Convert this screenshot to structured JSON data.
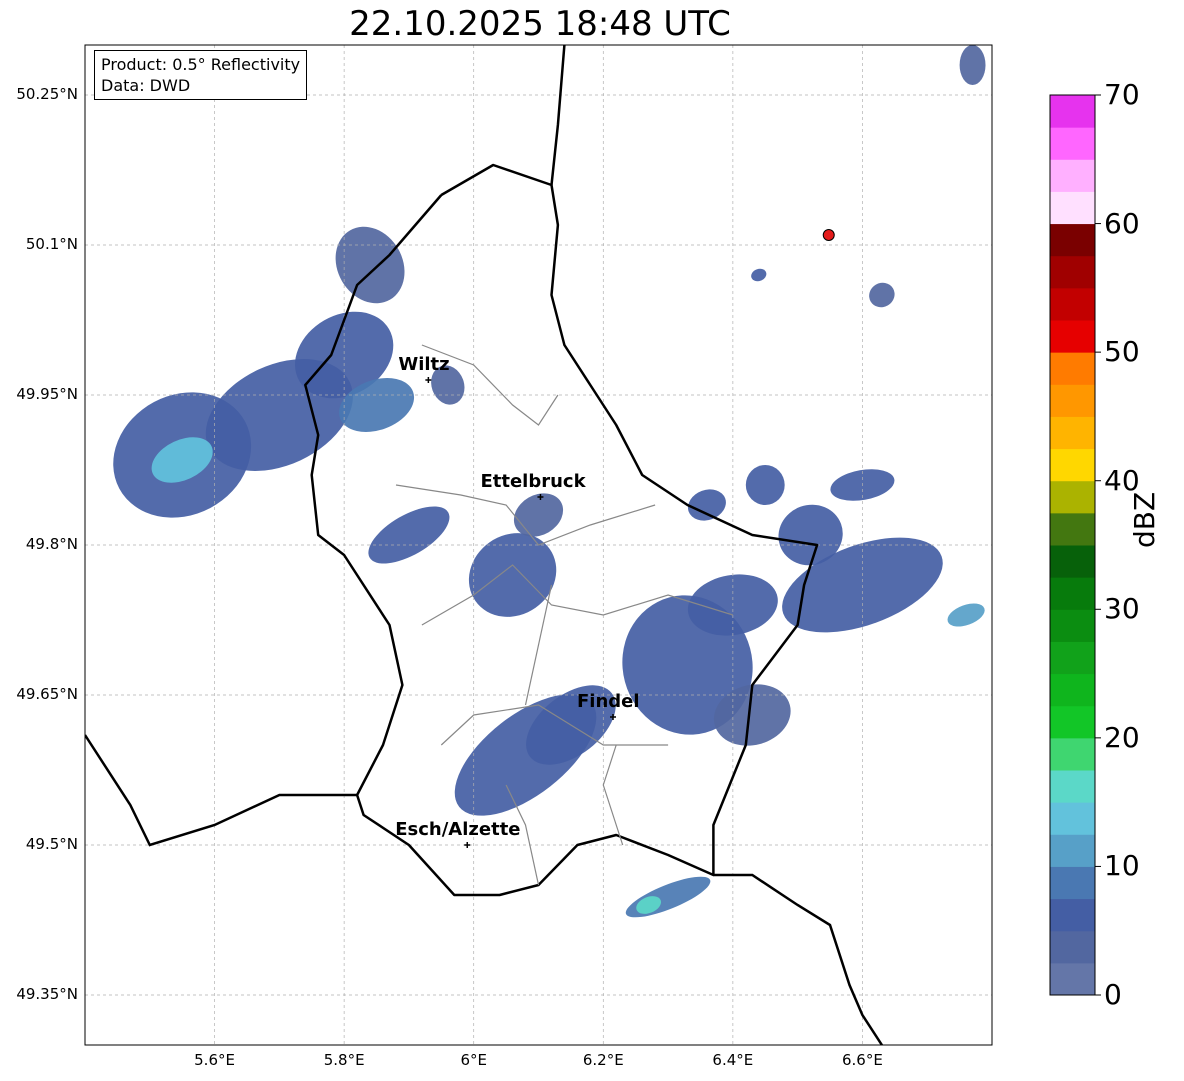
{
  "title": "22.10.2025 18:48 UTC",
  "info_box": {
    "product": "Product: 0.5° Reflectivity",
    "source": "Data: DWD"
  },
  "map": {
    "lon_range": [
      5.4,
      6.8
    ],
    "lat_range": [
      49.3,
      50.3
    ],
    "lat_ticks": [
      {
        "value": 50.25,
        "label": "50.25°N"
      },
      {
        "value": 50.1,
        "label": "50.1°N"
      },
      {
        "value": 49.95,
        "label": "49.95°N"
      },
      {
        "value": 49.8,
        "label": "49.8°N"
      },
      {
        "value": 49.65,
        "label": "49.65°N"
      },
      {
        "value": 49.5,
        "label": "49.5°N"
      },
      {
        "value": 49.35,
        "label": "49.35°N"
      }
    ],
    "lon_ticks": [
      {
        "value": 5.6,
        "label": "5.6°E"
      },
      {
        "value": 5.8,
        "label": "5.8°E"
      },
      {
        "value": 6.0,
        "label": "6°E"
      },
      {
        "value": 6.2,
        "label": "6.2°E"
      },
      {
        "value": 6.4,
        "label": "6.4°E"
      },
      {
        "value": 6.6,
        "label": "6.6°E"
      }
    ],
    "grid": true,
    "cities": [
      {
        "name": "Wiltz",
        "lon": 5.93,
        "lat": 49.965
      },
      {
        "name": "Ettelbruck",
        "lon": 6.103,
        "lat": 49.848
      },
      {
        "name": "Findel",
        "lon": 6.215,
        "lat": 49.628
      },
      {
        "name": "Esch/Alzette",
        "lon": 5.99,
        "lat": 49.5
      }
    ],
    "radar_site": {
      "lon": 6.548,
      "lat": 50.11,
      "color": "#e51b1b"
    },
    "echoes": [
      {
        "lon": 5.55,
        "lat": 49.89,
        "rx": 0.11,
        "ry": 0.06,
        "angle": -28,
        "dbz": 6
      },
      {
        "lon": 5.7,
        "lat": 49.93,
        "rx": 0.12,
        "ry": 0.05,
        "angle": -25,
        "dbz": 6
      },
      {
        "lon": 5.55,
        "lat": 49.885,
        "rx": 0.05,
        "ry": 0.02,
        "angle": -25,
        "dbz": 14
      },
      {
        "lon": 5.8,
        "lat": 49.99,
        "rx": 0.08,
        "ry": 0.04,
        "angle": -30,
        "dbz": 5
      },
      {
        "lon": 5.84,
        "lat": 50.08,
        "rx": 0.05,
        "ry": 0.04,
        "angle": -30,
        "dbz": 4
      },
      {
        "lon": 5.85,
        "lat": 49.94,
        "rx": 0.06,
        "ry": 0.025,
        "angle": -20,
        "dbz": 8
      },
      {
        "lon": 5.9,
        "lat": 49.81,
        "rx": 0.07,
        "ry": 0.02,
        "angle": -30,
        "dbz": 5
      },
      {
        "lon": 6.06,
        "lat": 49.77,
        "rx": 0.07,
        "ry": 0.04,
        "angle": -35,
        "dbz": 6
      },
      {
        "lon": 6.1,
        "lat": 49.83,
        "rx": 0.04,
        "ry": 0.02,
        "angle": -30,
        "dbz": 3
      },
      {
        "lon": 6.08,
        "lat": 49.59,
        "rx": 0.13,
        "ry": 0.04,
        "angle": -38,
        "dbz": 6
      },
      {
        "lon": 6.15,
        "lat": 49.62,
        "rx": 0.08,
        "ry": 0.03,
        "angle": -38,
        "dbz": 5
      },
      {
        "lon": 6.33,
        "lat": 49.68,
        "rx": 0.1,
        "ry": 0.07,
        "angle": -15,
        "dbz": 5
      },
      {
        "lon": 6.4,
        "lat": 49.74,
        "rx": 0.07,
        "ry": 0.03,
        "angle": -10,
        "dbz": 5
      },
      {
        "lon": 6.43,
        "lat": 49.63,
        "rx": 0.06,
        "ry": 0.03,
        "angle": -15,
        "dbz": 4
      },
      {
        "lon": 6.3,
        "lat": 49.448,
        "rx": 0.07,
        "ry": 0.012,
        "angle": -22,
        "dbz": 8
      },
      {
        "lon": 6.27,
        "lat": 49.44,
        "rx": 0.02,
        "ry": 0.008,
        "angle": -22,
        "dbz": 15
      },
      {
        "lon": 6.6,
        "lat": 49.76,
        "rx": 0.13,
        "ry": 0.04,
        "angle": -20,
        "dbz": 5
      },
      {
        "lon": 6.52,
        "lat": 49.81,
        "rx": 0.05,
        "ry": 0.03,
        "angle": -20,
        "dbz": 5
      },
      {
        "lon": 6.45,
        "lat": 49.86,
        "rx": 0.03,
        "ry": 0.02,
        "angle": 0,
        "dbz": 5
      },
      {
        "lon": 6.6,
        "lat": 49.86,
        "rx": 0.05,
        "ry": 0.015,
        "angle": -10,
        "dbz": 7
      },
      {
        "lon": 6.36,
        "lat": 49.84,
        "rx": 0.03,
        "ry": 0.015,
        "angle": -20,
        "dbz": 5
      },
      {
        "lon": 6.76,
        "lat": 49.73,
        "rx": 0.03,
        "ry": 0.01,
        "angle": -20,
        "dbz": 12
      },
      {
        "lon": 6.77,
        "lat": 50.28,
        "rx": 0.02,
        "ry": 0.02,
        "angle": 0,
        "dbz": 4
      },
      {
        "lon": 6.63,
        "lat": 50.05,
        "rx": 0.02,
        "ry": 0.012,
        "angle": -30,
        "dbz": 4
      },
      {
        "lon": 6.44,
        "lat": 50.07,
        "rx": 0.012,
        "ry": 0.006,
        "angle": -20,
        "dbz": 7
      },
      {
        "lon": 5.96,
        "lat": 49.96,
        "rx": 0.025,
        "ry": 0.02,
        "angle": -20,
        "dbz": 4
      }
    ],
    "borders_color": "#000000",
    "cantons_color": "#888888"
  },
  "colorbar": {
    "label": "dBZ",
    "min": 0,
    "max": 70,
    "step": 2.5,
    "ticks": [
      {
        "value": 0,
        "label": "0"
      },
      {
        "value": 10,
        "label": "10"
      },
      {
        "value": 20,
        "label": "20"
      },
      {
        "value": 30,
        "label": "30"
      },
      {
        "value": 40,
        "label": "40"
      },
      {
        "value": 50,
        "label": "50"
      },
      {
        "value": 60,
        "label": "60"
      },
      {
        "value": 70,
        "label": "70"
      }
    ],
    "colors": [
      "#6476a8",
      "#5267a0",
      "#445ea4",
      "#4a78b2",
      "#57a0c8",
      "#62c2dc",
      "#5bd8c8",
      "#3fd670",
      "#12c627",
      "#0fb51d",
      "#11a21a",
      "#0b8d11",
      "#077b0c",
      "#07610a",
      "#437710",
      "#abb300",
      "#ffd700",
      "#ffb400",
      "#ff9700",
      "#ff7b00",
      "#e60000",
      "#c20000",
      "#a00000",
      "#7a0000",
      "#ffe0ff",
      "#ffb0ff",
      "#ff66ff",
      "#e633ee"
    ]
  }
}
